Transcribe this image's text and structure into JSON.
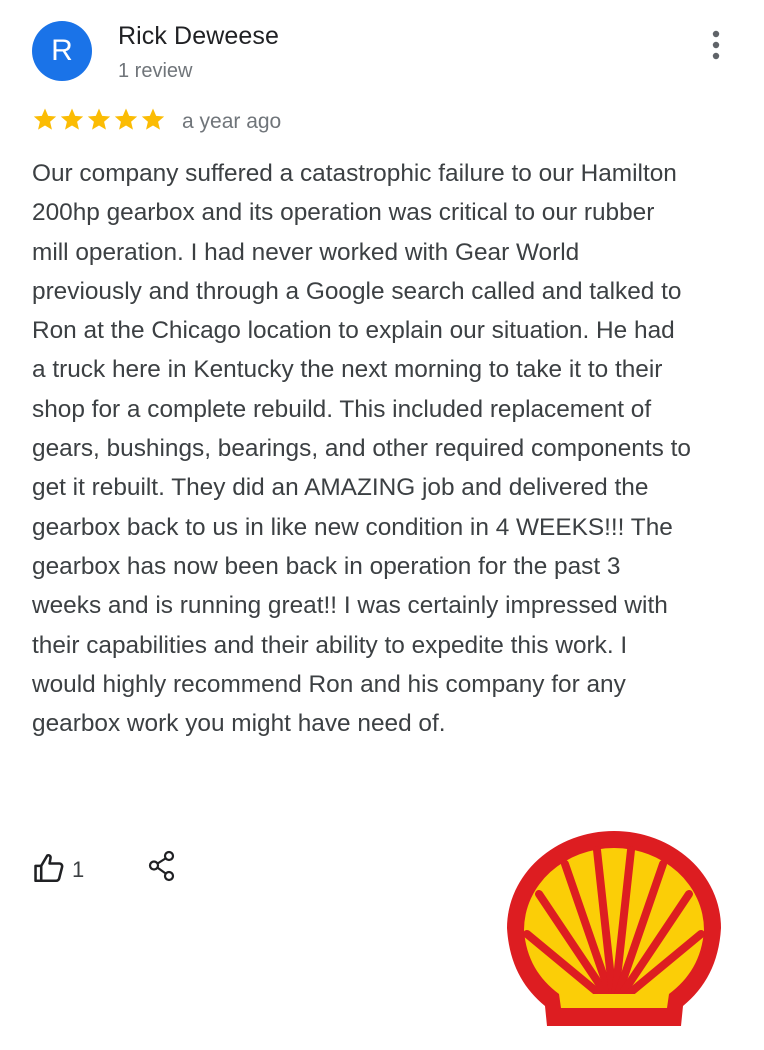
{
  "review": {
    "author": {
      "name": "Rick Deweese",
      "initial": "R",
      "review_count": "1 review",
      "avatar_color": "#1a73e8"
    },
    "rating": 5,
    "rating_max": 5,
    "star_color": "#fbbc04",
    "date": "a year ago",
    "text": "Our company suffered a catastrophic failure to our Hamilton 200hp gearbox and its operation was critical to our rubber mill operation. I had never worked with Gear World previously and through a Google search called and talked to Ron at the Chicago location to explain our situation. He had a truck here in Kentucky the next morning to take it to their shop for a complete rebuild. This included replacement of gears, bushings, bearings, and other required components to get it rebuilt. They did an AMAZING job and delivered the gearbox back to us in like new condition in 4 WEEKS!!! The gearbox has now been back in operation for the past 3 weeks and is running great!! I was certainly impressed with their capabilities and their ability to expedite this work. I would highly recommend Ron and his company for any gearbox work you might have need of.",
    "likes": "1"
  },
  "icons": {
    "more": "more-vert-icon",
    "like": "thumbs-up-icon",
    "share": "share-icon",
    "star": "star-icon",
    "logo": "shell-logo"
  },
  "logo_colors": {
    "red": "#dd1d21",
    "yellow": "#fbce07"
  }
}
